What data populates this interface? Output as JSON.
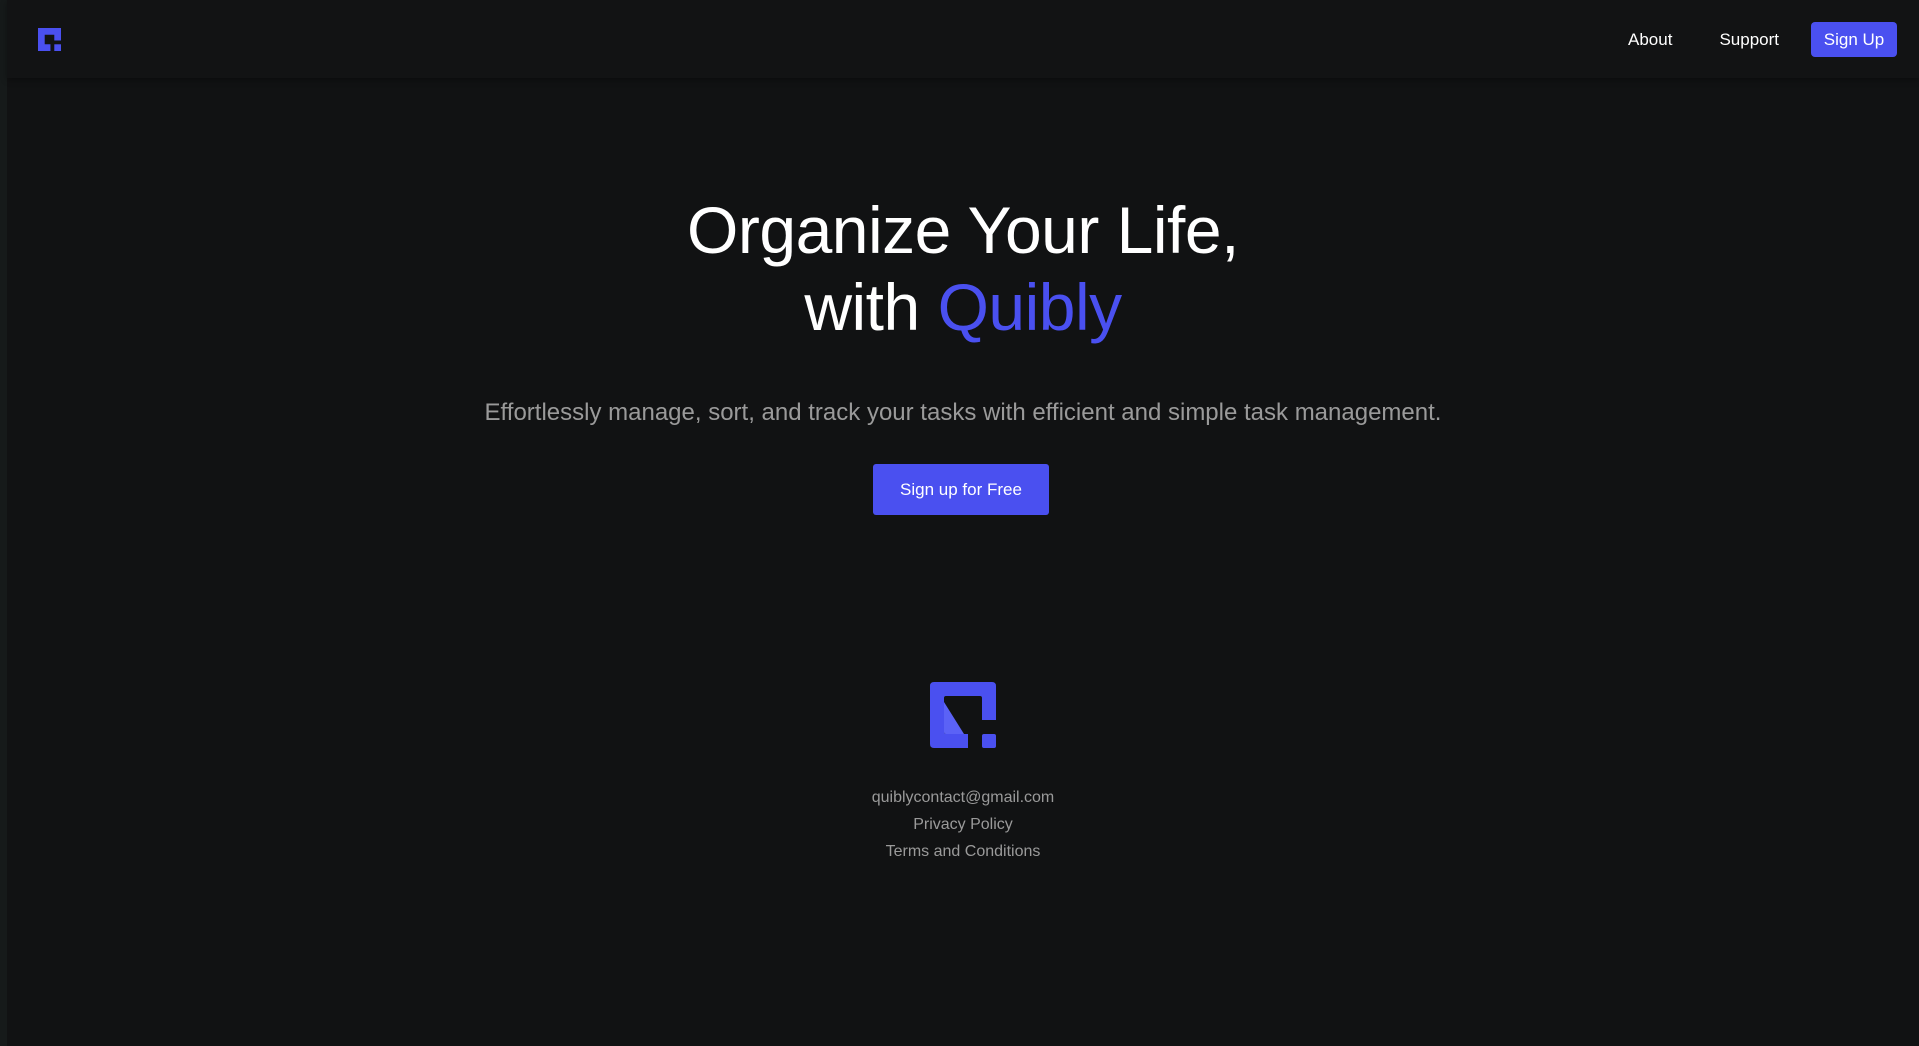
{
  "colors": {
    "accent": "#4a50f0",
    "background": "#111213",
    "muted_text": "#9a9a9a",
    "text": "#ffffff"
  },
  "navbar": {
    "logo_icon": "quibly-logo-icon",
    "links": {
      "about": "About",
      "support": "Support"
    },
    "signup_label": "Sign Up"
  },
  "hero": {
    "title_line1": "Organize Your Life,",
    "title_line2_prefix": "with",
    "title_brand": "Quibly",
    "subtitle": "Effortlessly manage, sort, and track your tasks with efficient and simple task management.",
    "cta_label": "Sign up for Free"
  },
  "footer": {
    "logo_icon": "quibly-logo-icon",
    "email": "quiblycontact@gmail.com",
    "privacy": "Privacy Policy",
    "terms": "Terms and Conditions"
  }
}
